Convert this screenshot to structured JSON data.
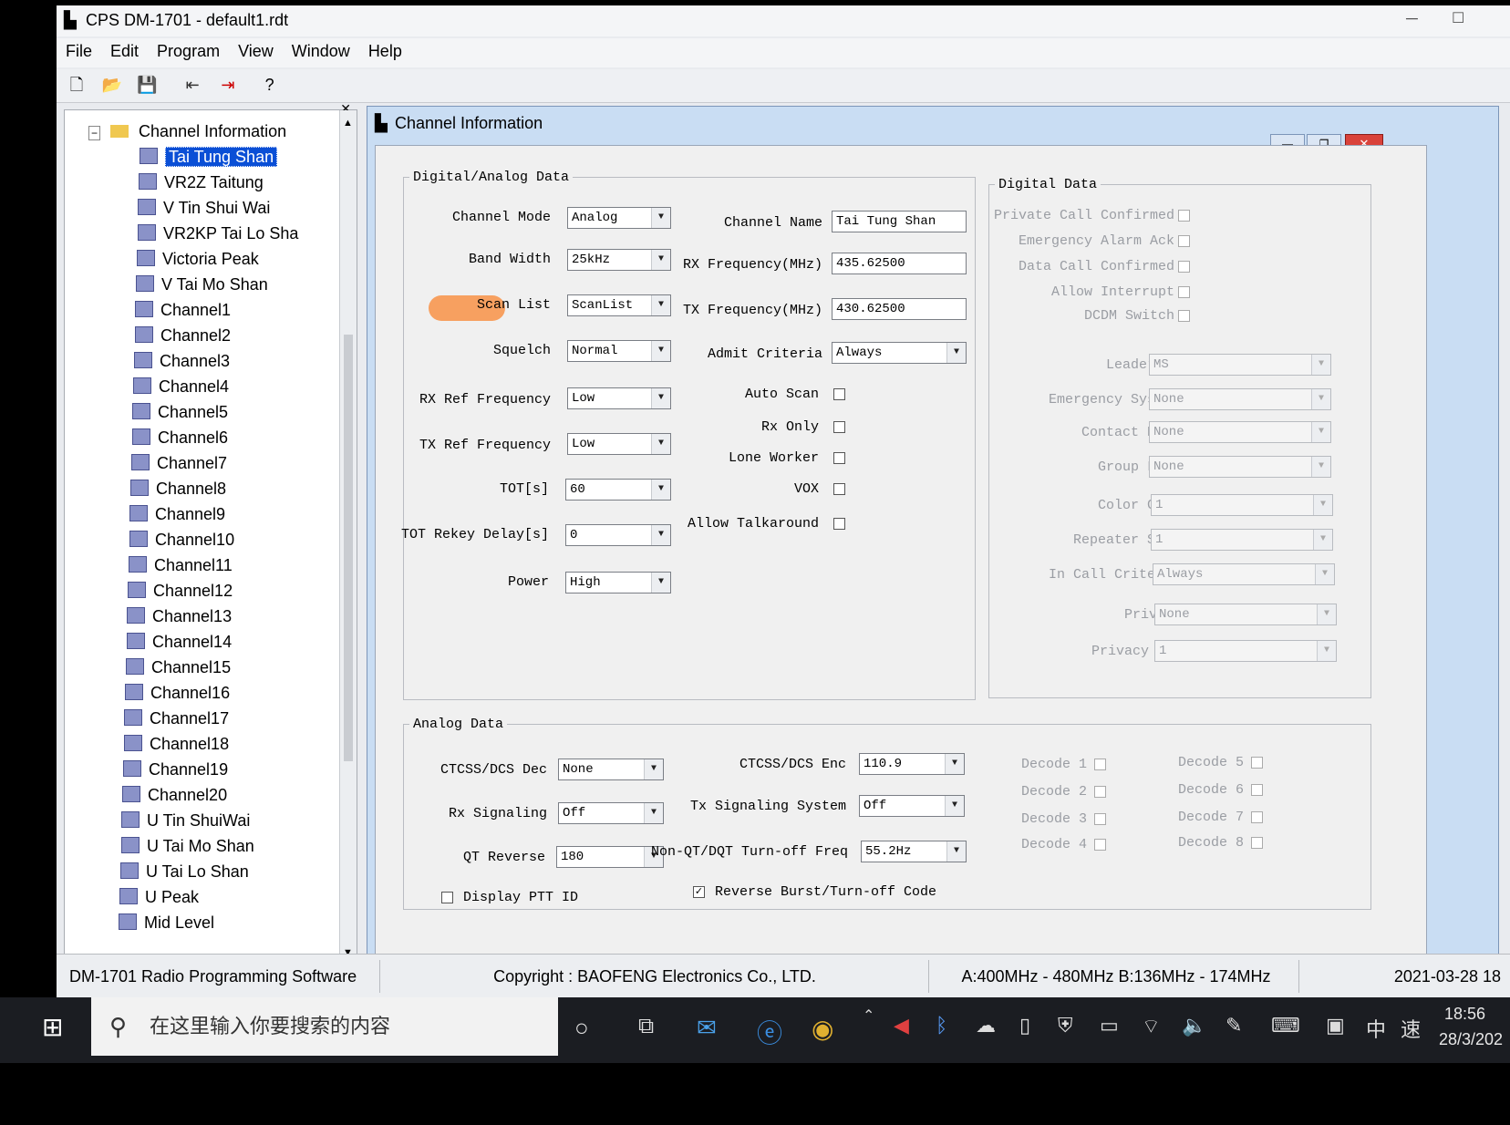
{
  "window": {
    "title": "CPS DM-1701 - default1.rdt"
  },
  "menu": [
    "File",
    "Edit",
    "Program",
    "View",
    "Window",
    "Help"
  ],
  "toolbar": {
    "icons": [
      "new-file-icon",
      "open-folder-icon",
      "save-icon",
      "read-radio-icon",
      "write-radio-icon",
      "help-icon"
    ]
  },
  "tree": {
    "root": "Channel Information",
    "items": [
      "Tai Tung Shan",
      "VR2Z Taitung",
      "V Tin Shui Wai",
      "VR2KP Tai Lo Sha",
      "Victoria Peak",
      "V Tai Mo Shan",
      "Channel1",
      "Channel2",
      "Channel3",
      "Channel4",
      "Channel5",
      "Channel6",
      "Channel7",
      "Channel8",
      "Channel9",
      "Channel10",
      "Channel11",
      "Channel12",
      "Channel13",
      "Channel14",
      "Channel15",
      "Channel16",
      "Channel17",
      "Channel18",
      "Channel19",
      "Channel20",
      "U Tin ShuiWai",
      "U Tai Mo Shan",
      "U Tai Lo Shan",
      "U Peak",
      "Mid Level"
    ],
    "selected": "Tai Tung Shan"
  },
  "child": {
    "title": "Channel Information",
    "da": {
      "legend": "Digital/Analog Data",
      "channel_mode_label": "Channel Mode",
      "channel_mode": "Analog",
      "band_width_label": "Band Width",
      "band_width": "25kHz",
      "scan_list_label": "Scan List",
      "scan_list": "ScanList",
      "squelch_label": "Squelch",
      "squelch": "Normal",
      "rx_ref_label": "RX Ref Frequency",
      "rx_ref": "Low",
      "tx_ref_label": "TX Ref Frequency",
      "tx_ref": "Low",
      "tot_label": "TOT[s]",
      "tot": "60",
      "tot_rekey_label": "TOT Rekey Delay[s]",
      "tot_rekey": "0",
      "power_label": "Power",
      "power": "High",
      "channel_name_label": "Channel Name",
      "channel_name": "Tai Tung Shan",
      "rx_freq_label": "RX Frequency(MHz)",
      "rx_freq": "435.62500",
      "tx_freq_label": "TX Frequency(MHz)",
      "tx_freq": "430.62500",
      "admit_label": "Admit Criteria",
      "admit": "Always",
      "auto_scan_label": "Auto Scan",
      "rx_only_label": "Rx Only",
      "lone_worker_label": "Lone Worker",
      "vox_label": "VOX",
      "talkaround_label": "Allow Talkaround"
    },
    "digital": {
      "legend": "Digital Data",
      "private_call_label": "Private Call Confirmed",
      "emergency_ack_label": "Emergency Alarm Ack",
      "data_call_label": "Data Call Confirmed",
      "allow_interrupt_label": "Allow Interrupt",
      "dcdm_label": "DCDM Switch",
      "leader_label": "Leader/MS",
      "leader": "MS",
      "emergency_system_label": "Emergency System",
      "emergency_system": "None",
      "contact_name_label": "Contact Name",
      "contact_name": "None",
      "group_list_label": "Group List",
      "group_list": "None",
      "color_code_label": "Color Code",
      "color_code": "1",
      "repeater_slot_label": "Repeater Slot",
      "repeater_slot": "1",
      "in_call_label": "In Call Criteria",
      "in_call": "Always",
      "privacy_label": "Privacy",
      "privacy": "None",
      "privacy_no_label": "Privacy No.",
      "privacy_no": "1"
    },
    "analog": {
      "legend": "Analog Data",
      "ctcss_dec_label": "CTCSS/DCS Dec",
      "ctcss_dec": "None",
      "rx_signaling_label": "Rx Signaling",
      "rx_signaling": "Off",
      "qt_reverse_label": "QT Reverse",
      "qt_reverse": "180",
      "ctcss_enc_label": "CTCSS/DCS Enc",
      "ctcss_enc": "110.9",
      "tx_signaling_label": "Tx Signaling System",
      "tx_signaling": "Off",
      "turnoff_label": "Non-QT/DQT Turn-off Freq",
      "turnoff": "55.2Hz",
      "display_ptt_label": "Display PTT ID",
      "display_ptt": false,
      "reverse_burst_label": "Reverse Burst/Turn-off Code",
      "reverse_burst": true,
      "decodes": [
        "Decode 1",
        "Decode 2",
        "Decode 3",
        "Decode 4",
        "Decode 5",
        "Decode 6",
        "Decode 7",
        "Decode 8"
      ]
    }
  },
  "status": {
    "app": "DM-1701 Radio Programming Software",
    "copyright": "Copyright : BAOFENG Electronics Co., LTD.",
    "range": "A:400MHz - 480MHz B:136MHz - 174MHz",
    "date": "2021-03-28 18"
  },
  "taskbar": {
    "search_placeholder": "在这里输入你要搜索的内容",
    "time": "18:56",
    "date": "28/3/202",
    "ime1": "中",
    "ime2": "速"
  },
  "colors": {
    "selection": "#0a4fd6",
    "window_bg": "#e9ebef",
    "close_button": "#d9423a",
    "taskbar": "#1b1d22"
  }
}
